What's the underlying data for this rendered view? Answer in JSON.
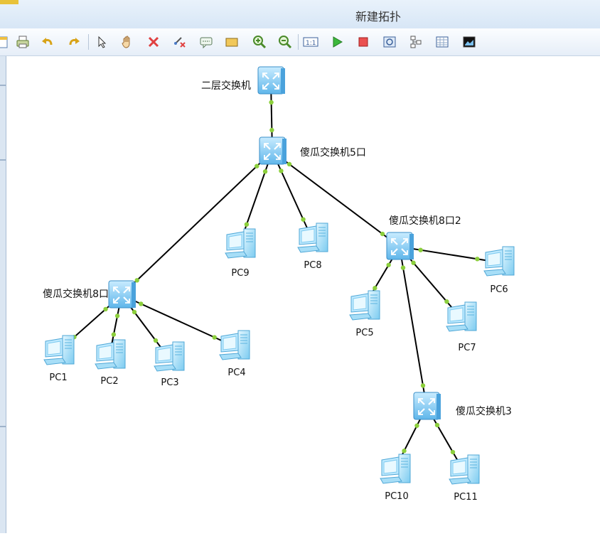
{
  "window": {
    "title": "新建拓扑"
  },
  "toolbar": {
    "buttons": [
      {
        "name": "new-icon"
      },
      {
        "name": "print-icon"
      },
      {
        "name": "undo-icon"
      },
      {
        "name": "redo-icon"
      },
      {
        "name": "select-pointer-icon"
      },
      {
        "name": "hand-pan-icon"
      },
      {
        "name": "delete-icon"
      },
      {
        "name": "delete-link-icon"
      },
      {
        "name": "text-note-icon"
      },
      {
        "name": "palette-icon"
      },
      {
        "name": "zoom-in-icon"
      },
      {
        "name": "zoom-out-icon"
      },
      {
        "name": "actual-size-icon"
      },
      {
        "name": "start-device-icon"
      },
      {
        "name": "stop-device-icon"
      },
      {
        "name": "capture-icon"
      },
      {
        "name": "topology-icon"
      },
      {
        "name": "grid-icon"
      },
      {
        "name": "screenshot-icon"
      }
    ]
  },
  "topology": {
    "devices": {
      "l2switch": {
        "label": "二层交换机",
        "type": "switch"
      },
      "sw5": {
        "label": "傻瓜交换机5口",
        "type": "switch"
      },
      "sw8a": {
        "label": "傻瓜交换机8口",
        "type": "switch"
      },
      "sw8b": {
        "label": "傻瓜交换机8口2",
        "type": "switch"
      },
      "sw3": {
        "label": "傻瓜交换机3",
        "type": "switch"
      },
      "pc1": {
        "label": "PC1",
        "type": "pc"
      },
      "pc2": {
        "label": "PC2",
        "type": "pc"
      },
      "pc3": {
        "label": "PC3",
        "type": "pc"
      },
      "pc4": {
        "label": "PC4",
        "type": "pc"
      },
      "pc5": {
        "label": "PC5",
        "type": "pc"
      },
      "pc6": {
        "label": "PC6",
        "type": "pc"
      },
      "pc7": {
        "label": "PC7",
        "type": "pc"
      },
      "pc8": {
        "label": "PC8",
        "type": "pc"
      },
      "pc9": {
        "label": "PC9",
        "type": "pc"
      },
      "pc10": {
        "label": "PC10",
        "type": "pc"
      },
      "pc11": {
        "label": "PC11",
        "type": "pc"
      }
    },
    "links": [
      [
        "l2switch",
        "sw5"
      ],
      [
        "sw5",
        "sw8a"
      ],
      [
        "sw5",
        "pc9"
      ],
      [
        "sw5",
        "pc8"
      ],
      [
        "sw5",
        "sw8b"
      ],
      [
        "sw8a",
        "pc1"
      ],
      [
        "sw8a",
        "pc2"
      ],
      [
        "sw8a",
        "pc3"
      ],
      [
        "sw8a",
        "pc4"
      ],
      [
        "sw8b",
        "pc5"
      ],
      [
        "sw8b",
        "pc6"
      ],
      [
        "sw8b",
        "pc7"
      ],
      [
        "sw8b",
        "sw3"
      ],
      [
        "sw3",
        "pc10"
      ],
      [
        "sw3",
        "pc11"
      ]
    ],
    "colors": {
      "link": "#000000",
      "port": "#8ccf3c",
      "switch_body": "#7fc8f2",
      "pc_body": "#9fdcf7"
    }
  }
}
